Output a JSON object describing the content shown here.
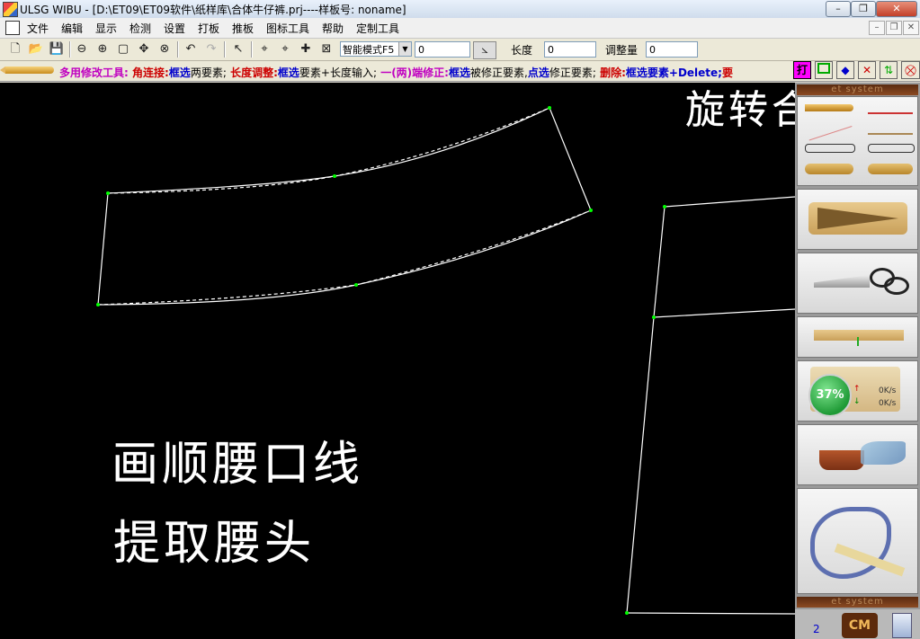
{
  "window": {
    "title": "ULSG WIBU - [D:\\ET09\\ET09软件\\纸样库\\合体牛仔裤.prj----样板号: noname]",
    "minimize": "–",
    "restore": "❐",
    "close": "✕"
  },
  "menu": {
    "items": [
      "文件",
      "编辑",
      "显示",
      "检测",
      "设置",
      "打板",
      "推板",
      "图标工具",
      "帮助",
      "定制工具"
    ]
  },
  "toolbar": {
    "mode_select": "智能模式F5",
    "value_field": "0",
    "length_label": "长度",
    "length_value": "0",
    "adjust_label": "调整量",
    "adjust_value": "0"
  },
  "infobar": {
    "tool_name": "多用修改工具:",
    "segments": [
      {
        "text": "角连接:",
        "color": "red"
      },
      {
        "text": "框选",
        "color": "blue"
      },
      {
        "text": "两要素;",
        "color": "black"
      },
      {
        "text": "长度调整:",
        "color": "red"
      },
      {
        "text": "框选",
        "color": "blue"
      },
      {
        "text": "要素+长度输入;",
        "color": "black"
      },
      {
        "text": "一(两)端修正:",
        "color": "magenta"
      },
      {
        "text": "框选",
        "color": "blue"
      },
      {
        "text": "被修正要素,",
        "color": "black"
      },
      {
        "text": "点选",
        "color": "blue"
      },
      {
        "text": "修正要素;",
        "color": "black"
      },
      {
        "text": "删除:",
        "color": "red"
      },
      {
        "text": "框选要素",
        "color": "blue"
      },
      {
        "text": "+Delete;",
        "color": "blue"
      },
      {
        "text": "要",
        "color": "red"
      }
    ]
  },
  "canvas": {
    "annotations": [
      "画顺腰口线",
      "提取腰头",
      "旋转合"
    ]
  },
  "panel": {
    "header": "et system",
    "footer_header": "et system",
    "net_percent": "37%",
    "upload_speed": "0K/s",
    "download_speed": "0K/s",
    "bottom_number": "2",
    "cm_label": "CM"
  },
  "colors": {
    "canvas_bg": "#000000",
    "line": "#ffffff",
    "point": "#00ff00",
    "info_red": "#cc0000",
    "info_blue": "#0000cc",
    "info_magenta": "#c000c0"
  }
}
